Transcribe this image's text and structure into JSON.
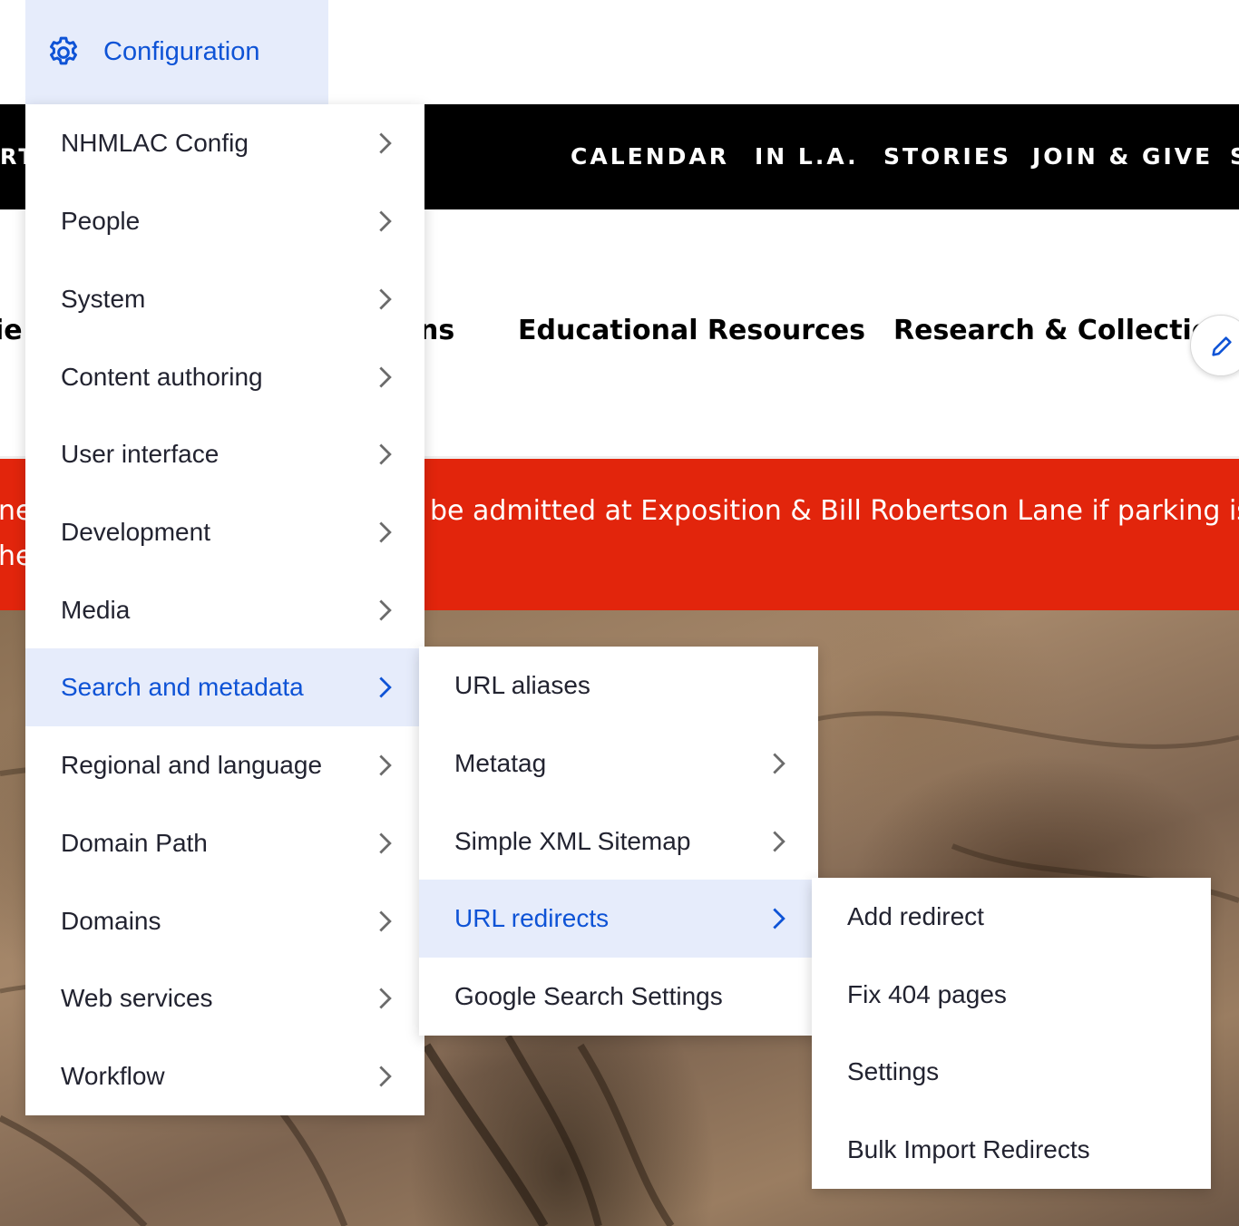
{
  "toolbar": {
    "config_label": "Configuration"
  },
  "site": {
    "top_nav_cut": "RT",
    "top_nav": [
      "CALENDAR",
      "IN L.A.",
      "STORIES",
      "JOIN & GIVE",
      "S"
    ],
    "secondary_nav": [
      "ie",
      "ns",
      "Educational Resources",
      "Research & Collections"
    ],
    "alert_line1_left": "ne",
    "alert_line1": "be admitted at Exposition & Bill Robertson Lane if parking is a",
    "alert_line2_left": "he"
  },
  "menu_level1": {
    "items": [
      {
        "label": "NHMLAC Config"
      },
      {
        "label": "People"
      },
      {
        "label": "System"
      },
      {
        "label": "Content authoring"
      },
      {
        "label": "User interface"
      },
      {
        "label": "Development"
      },
      {
        "label": "Media"
      },
      {
        "label": "Search and metadata"
      },
      {
        "label": "Regional and language"
      },
      {
        "label": "Domain Path"
      },
      {
        "label": "Domains"
      },
      {
        "label": "Web services"
      },
      {
        "label": "Workflow"
      }
    ]
  },
  "menu_level2": {
    "items": [
      {
        "label": "URL aliases"
      },
      {
        "label": "Metatag"
      },
      {
        "label": "Simple XML Sitemap"
      },
      {
        "label": "URL redirects"
      },
      {
        "label": "Google Search Settings"
      }
    ]
  },
  "menu_level3": {
    "items": [
      {
        "label": "Add redirect"
      },
      {
        "label": "Fix 404 pages"
      },
      {
        "label": "Settings"
      },
      {
        "label": "Bulk Import Redirects"
      }
    ]
  },
  "colors": {
    "accent": "#0e53d6",
    "active_bg": "#e6ecfb",
    "alert_bg": "#e2250c",
    "text": "#222330",
    "chevron": "#6b6b6b"
  }
}
